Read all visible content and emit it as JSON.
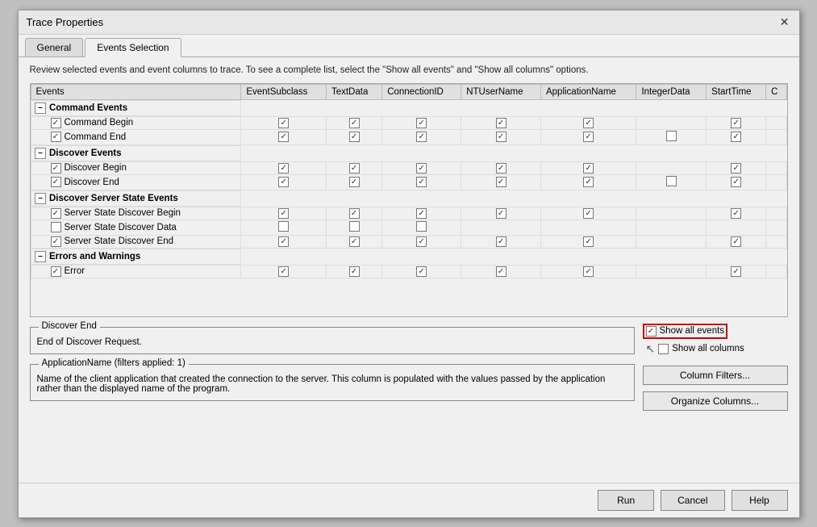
{
  "dialog": {
    "title": "Trace Properties",
    "close_label": "✕"
  },
  "tabs": [
    {
      "id": "general",
      "label": "General",
      "active": false
    },
    {
      "id": "events-selection",
      "label": "Events Selection",
      "active": true
    }
  ],
  "description": "Review selected events and event columns to trace. To see a complete list, select the \"Show all events\" and \"Show all columns\" options.",
  "table": {
    "columns": [
      "Events",
      "EventSubclass",
      "TextData",
      "ConnectionID",
      "NTUserName",
      "ApplicationName",
      "IntegerData",
      "StartTime",
      "C"
    ],
    "groups": [
      {
        "name": "Command Events",
        "expanded": true,
        "rows": [
          {
            "name": "Command Begin",
            "checks": [
              true,
              true,
              true,
              true,
              true,
              true,
              false,
              true
            ]
          },
          {
            "name": "Command End",
            "checks": [
              true,
              true,
              true,
              true,
              true,
              false,
              false,
              true
            ]
          }
        ]
      },
      {
        "name": "Discover Events",
        "expanded": true,
        "rows": [
          {
            "name": "Discover Begin",
            "checks": [
              true,
              true,
              true,
              true,
              true,
              true,
              false,
              true
            ]
          },
          {
            "name": "Discover End",
            "checks": [
              true,
              true,
              true,
              true,
              true,
              false,
              false,
              true
            ]
          }
        ]
      },
      {
        "name": "Discover Server State Events",
        "expanded": true,
        "rows": [
          {
            "name": "Server State Discover Begin",
            "checks": [
              true,
              true,
              true,
              true,
              true,
              true,
              false,
              true
            ]
          },
          {
            "name": "Server State Discover Data",
            "checks": [
              false,
              false,
              false,
              false,
              false,
              false,
              false,
              false
            ]
          },
          {
            "name": "Server State Discover End",
            "checks": [
              true,
              true,
              true,
              true,
              true,
              true,
              false,
              true
            ]
          }
        ]
      },
      {
        "name": "Errors and Warnings",
        "expanded": true,
        "rows": [
          {
            "name": "Error",
            "checks": [
              true,
              true,
              true,
              true,
              true,
              false,
              false,
              true
            ]
          }
        ]
      }
    ]
  },
  "discover_end_box": {
    "title": "Discover End",
    "description": "End of Discover Request."
  },
  "show_all_events": {
    "label": "Show all events",
    "checked": true
  },
  "show_all_columns": {
    "label": "Show all columns",
    "checked": false
  },
  "application_name_box": {
    "title": "ApplicationName (filters applied: 1)",
    "description": "Name of the client application that created the connection to the server. This column is populated with the values passed by the application rather than the displayed name of the program."
  },
  "buttons": {
    "column_filters": "Column Filters...",
    "organize_columns": "Organize Columns...",
    "run": "Run",
    "cancel": "Cancel",
    "help": "Help"
  }
}
